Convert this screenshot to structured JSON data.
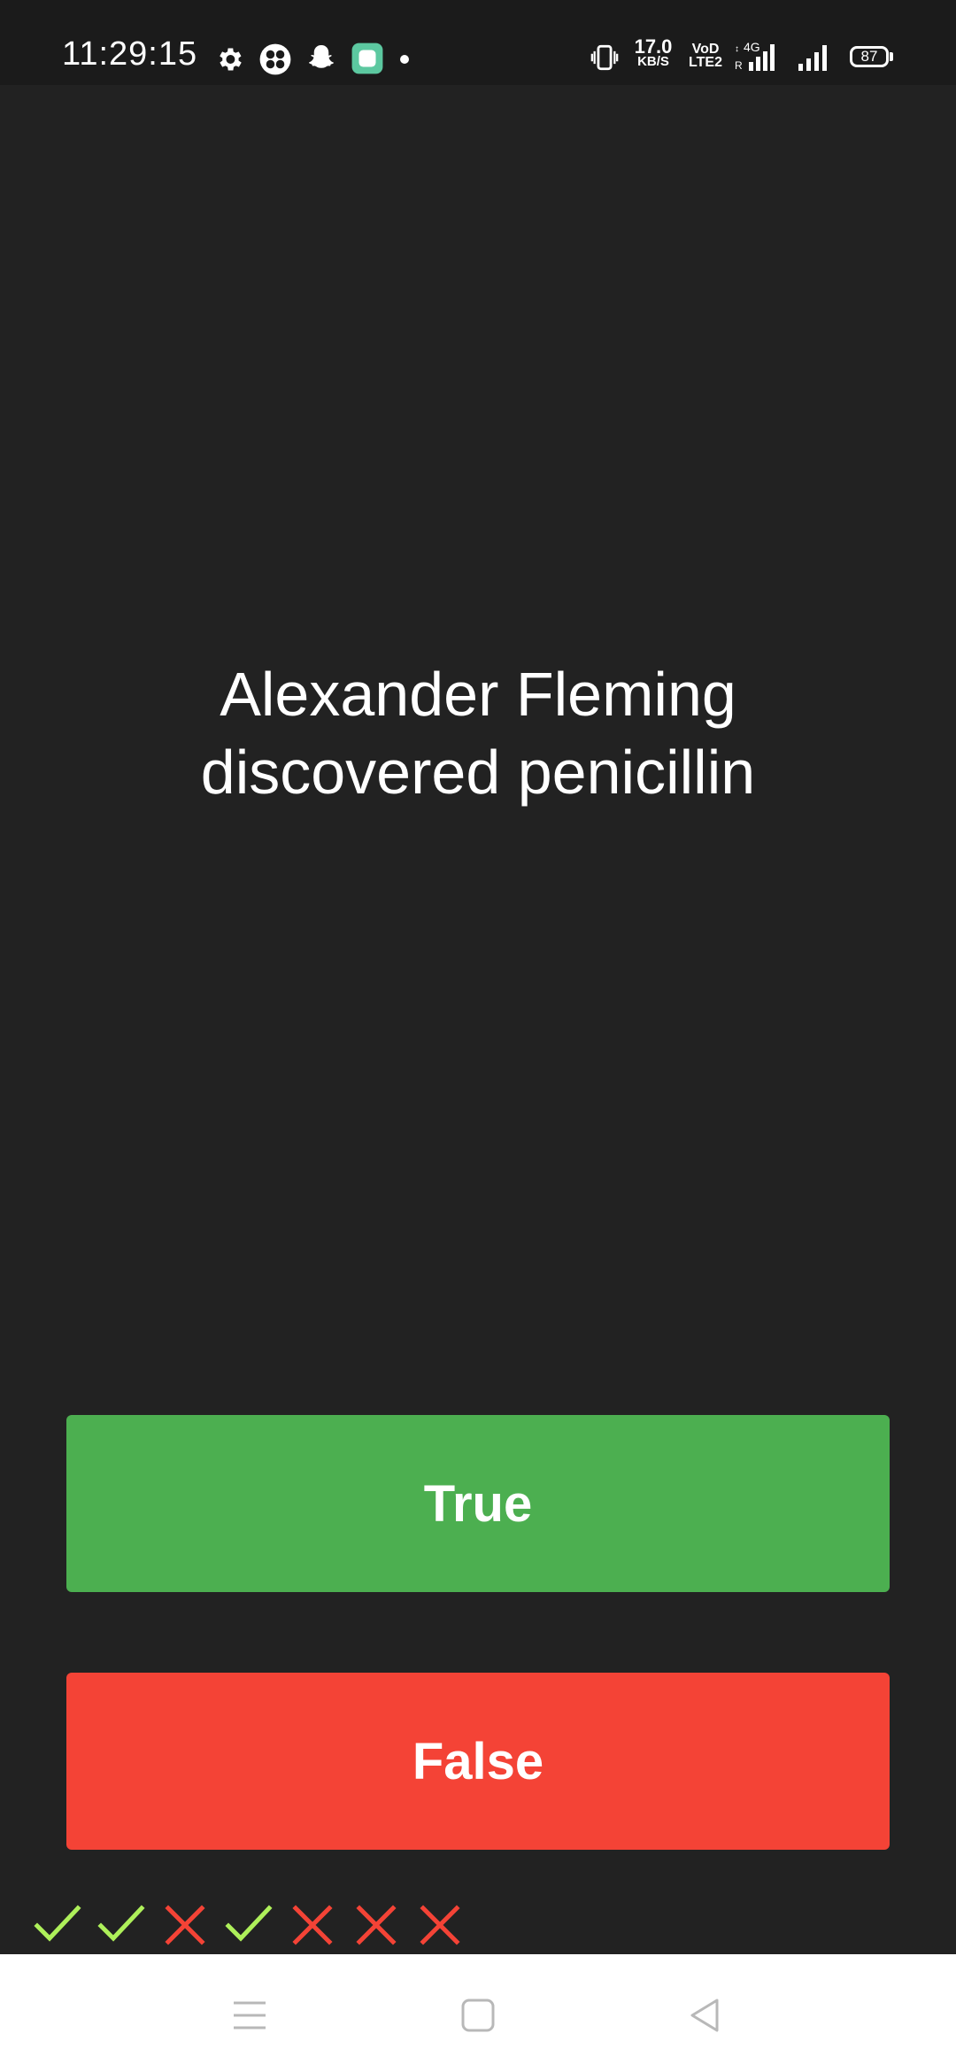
{
  "status_bar": {
    "time": "11:29:15",
    "icons": [
      "settings-icon",
      "app-icon",
      "snapchat-icon",
      "app-badge-icon",
      "notification-dot-icon"
    ],
    "net_speed_value": "17.0",
    "net_speed_unit": "KB/S",
    "volte_top": "VoD",
    "volte_bottom": "LTE2",
    "network": "4G",
    "battery": "87"
  },
  "quiz": {
    "question": "Alexander Fleming discovered penicillin",
    "true_label": "True",
    "false_label": "False"
  },
  "score": {
    "results": [
      "correct",
      "correct",
      "wrong",
      "correct",
      "wrong",
      "wrong",
      "wrong"
    ],
    "colors": {
      "correct": "#aef05a",
      "wrong": "#f44336"
    }
  },
  "colors": {
    "background": "#222222",
    "true_button": "#4caf50",
    "false_button": "#f44336"
  },
  "nav_bar": {
    "icons": [
      "menu-icon",
      "home-icon",
      "back-icon"
    ]
  }
}
